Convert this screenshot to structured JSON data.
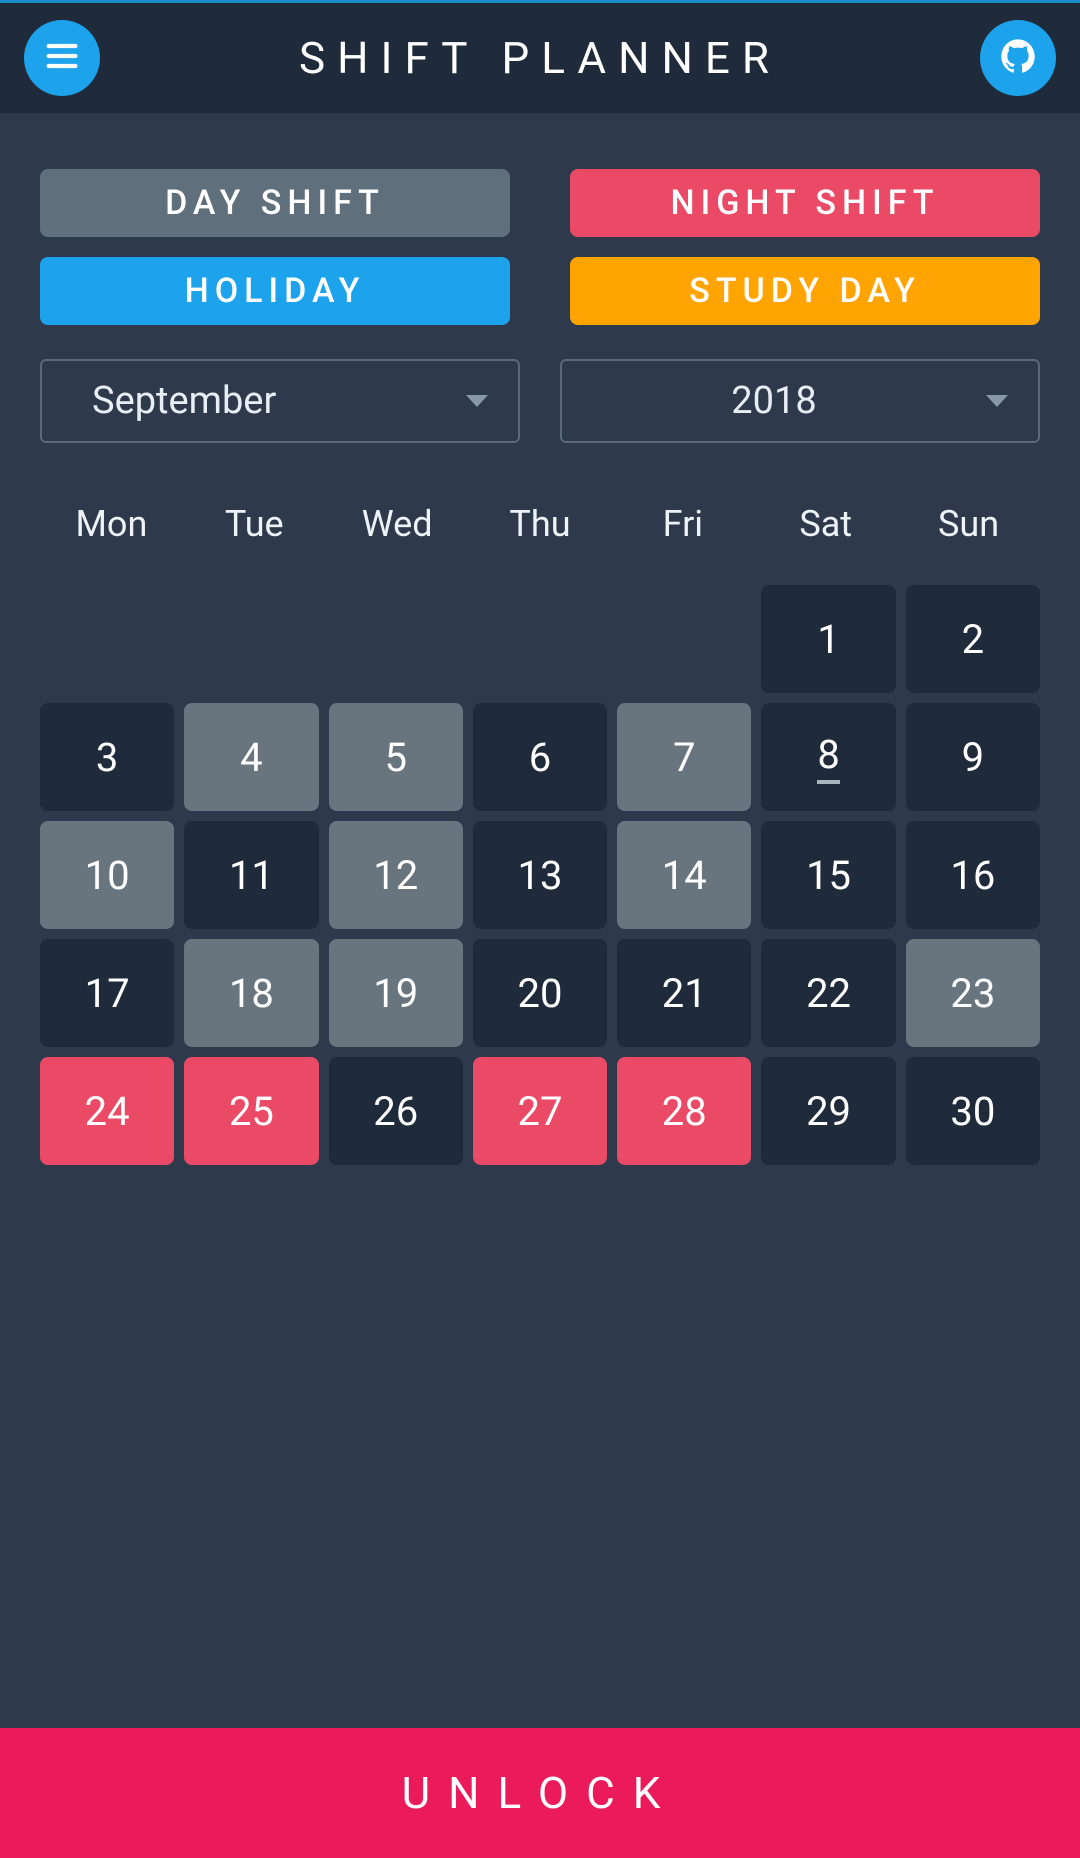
{
  "colors": {
    "day": "#68757f",
    "night": "#ea4a66",
    "holiday": "#1ca3ec",
    "study": "#ffa400",
    "default": "#1f2a3a"
  },
  "header": {
    "title": "SHIFT PLANNER",
    "menu_icon": "menu-icon",
    "right_icon": "github-icon"
  },
  "shift_buttons": [
    {
      "id": "day-shift",
      "label": "DAY SHIFT",
      "class": "c-gray"
    },
    {
      "id": "night-shift",
      "label": "NIGHT SHIFT",
      "class": "c-pink"
    },
    {
      "id": "holiday",
      "label": "HOLIDAY",
      "class": "c-blue"
    },
    {
      "id": "study-day",
      "label": "STUDY DAY",
      "class": "c-orange"
    }
  ],
  "selects": {
    "month": "September",
    "year": "2018"
  },
  "weekdays": [
    "Mon",
    "Tue",
    "Wed",
    "Thu",
    "Fri",
    "Sat",
    "Sun"
  ],
  "calendar": {
    "leading_blanks": 5,
    "today": 8,
    "days": [
      {
        "n": 1,
        "state": "default"
      },
      {
        "n": 2,
        "state": "default"
      },
      {
        "n": 3,
        "state": "default"
      },
      {
        "n": 4,
        "state": "day"
      },
      {
        "n": 5,
        "state": "day"
      },
      {
        "n": 6,
        "state": "default"
      },
      {
        "n": 7,
        "state": "day"
      },
      {
        "n": 8,
        "state": "default"
      },
      {
        "n": 9,
        "state": "default"
      },
      {
        "n": 10,
        "state": "day"
      },
      {
        "n": 11,
        "state": "default"
      },
      {
        "n": 12,
        "state": "day"
      },
      {
        "n": 13,
        "state": "default"
      },
      {
        "n": 14,
        "state": "day"
      },
      {
        "n": 15,
        "state": "default"
      },
      {
        "n": 16,
        "state": "default"
      },
      {
        "n": 17,
        "state": "default"
      },
      {
        "n": 18,
        "state": "day"
      },
      {
        "n": 19,
        "state": "day"
      },
      {
        "n": 20,
        "state": "default"
      },
      {
        "n": 21,
        "state": "default"
      },
      {
        "n": 22,
        "state": "default"
      },
      {
        "n": 23,
        "state": "day"
      },
      {
        "n": 24,
        "state": "night"
      },
      {
        "n": 25,
        "state": "night"
      },
      {
        "n": 26,
        "state": "default"
      },
      {
        "n": 27,
        "state": "night"
      },
      {
        "n": 28,
        "state": "night"
      },
      {
        "n": 29,
        "state": "default"
      },
      {
        "n": 30,
        "state": "default"
      }
    ]
  },
  "footer": {
    "label": "UNLOCK"
  }
}
